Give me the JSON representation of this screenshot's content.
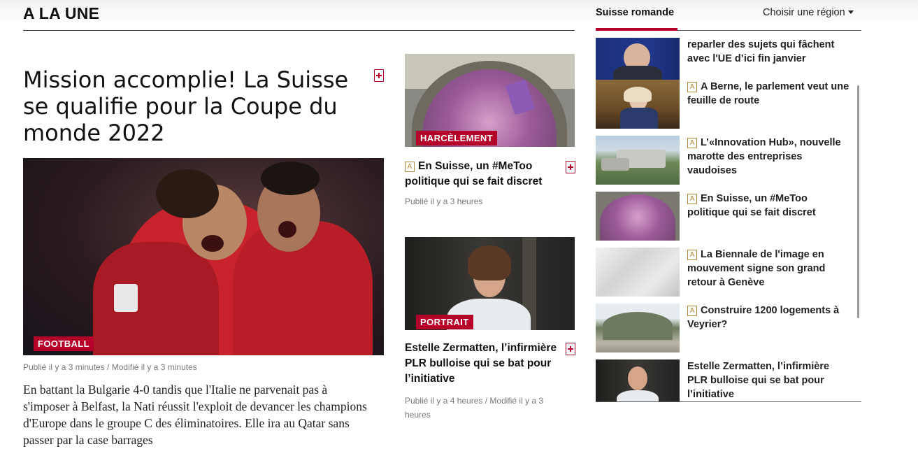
{
  "section": {
    "title": "A LA UNE"
  },
  "main_article": {
    "headline": "Mission accomplie! La Suisse se qualifie pour la Coupe du monde 2022",
    "tag": "FOOTBALL",
    "meta": "Publié il y a 3 minutes  /  Modifié il y a 3 minutes",
    "lede": "En battant la Bulgarie 4-0 tandis que l'Italie ne parvenait pas à s'imposer à Belfast, la Nati réussit l'exploit de devancer les champions d'Europe dans le groupe C des éliminatoires. Elle ira au Qatar sans passer par la case barrages"
  },
  "middle_articles": [
    {
      "tag": "HARCÈLEMENT",
      "badge": "A",
      "title": "En Suisse, un #MeToo politique qui se fait discret",
      "meta": "Publié il y a 3 heures"
    },
    {
      "tag": "PORTRAIT",
      "title": "Estelle Zermatten, l’infirmière PLR bulloise qui se bat pour l’initiative",
      "meta": "Publié il y a 4 heures  /  Modifié il y a 3 heures"
    }
  ],
  "right_panel": {
    "active_tab": "Suisse romande",
    "region_select": "Choisir une région",
    "items": [
      {
        "badge": "",
        "title": "reparler des sujets qui fâchent avec l'UE d’ici fin janvier"
      },
      {
        "badge": "A",
        "title": "A Berne, le parlement veut une feuille de route"
      },
      {
        "badge": "A",
        "title": "L’«Innovation Hub», nouvelle marotte des entreprises vaudoises"
      },
      {
        "badge": "A",
        "title": "En Suisse, un #MeToo politique qui se fait discret"
      },
      {
        "badge": "A",
        "title": "La Biennale de l'image en mouvement signe son grand retour à Genève"
      },
      {
        "badge": "A",
        "title": "Construire 1200 logements à Veyrier?"
      },
      {
        "badge": "",
        "title": "Estelle Zermatten, l’infirmière PLR bulloise qui se bat pour l’initiative"
      }
    ]
  },
  "colors": {
    "accent": "#b5002a",
    "badge": "#b08a3c"
  }
}
